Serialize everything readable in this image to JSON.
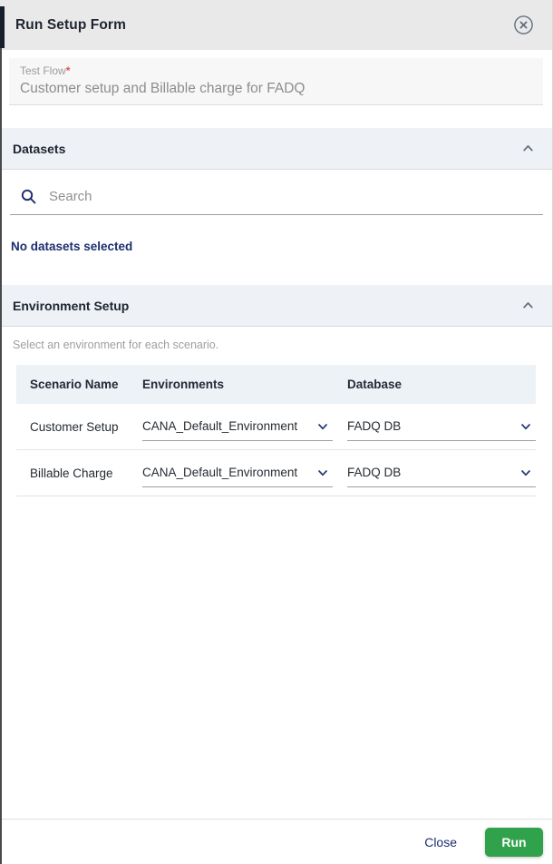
{
  "dialog": {
    "title": "Run Setup Form"
  },
  "test_flow": {
    "label": "Test Flow",
    "required_marker": "*",
    "value": "Customer setup and Billable charge for FADQ"
  },
  "datasets": {
    "header": "Datasets",
    "search_placeholder": "Search",
    "empty_text": "No datasets selected"
  },
  "environment_setup": {
    "header": "Environment Setup",
    "helper": "Select an environment for each scenario.",
    "table": {
      "columns": [
        "Scenario Name",
        "Environments",
        "Database"
      ],
      "rows": [
        {
          "scenario": "Customer Setup",
          "environment": "CANA_Default_Environment",
          "database": "FADQ DB"
        },
        {
          "scenario": "Billable Charge",
          "environment": "CANA_Default_Environment",
          "database": "FADQ DB"
        }
      ]
    }
  },
  "footer": {
    "close_label": "Close",
    "run_label": "Run"
  },
  "icons": {
    "close": "circle-x-icon",
    "search": "magnifier-icon",
    "collapse": "chevron-up-icon",
    "dropdown": "chevron-down-icon"
  },
  "colors": {
    "header_bg": "#e9e9e9",
    "section_bg": "#eef1f6",
    "accent_navy": "#1c2e6d",
    "run_green": "#31a24c",
    "required_red": "#e0524d"
  }
}
